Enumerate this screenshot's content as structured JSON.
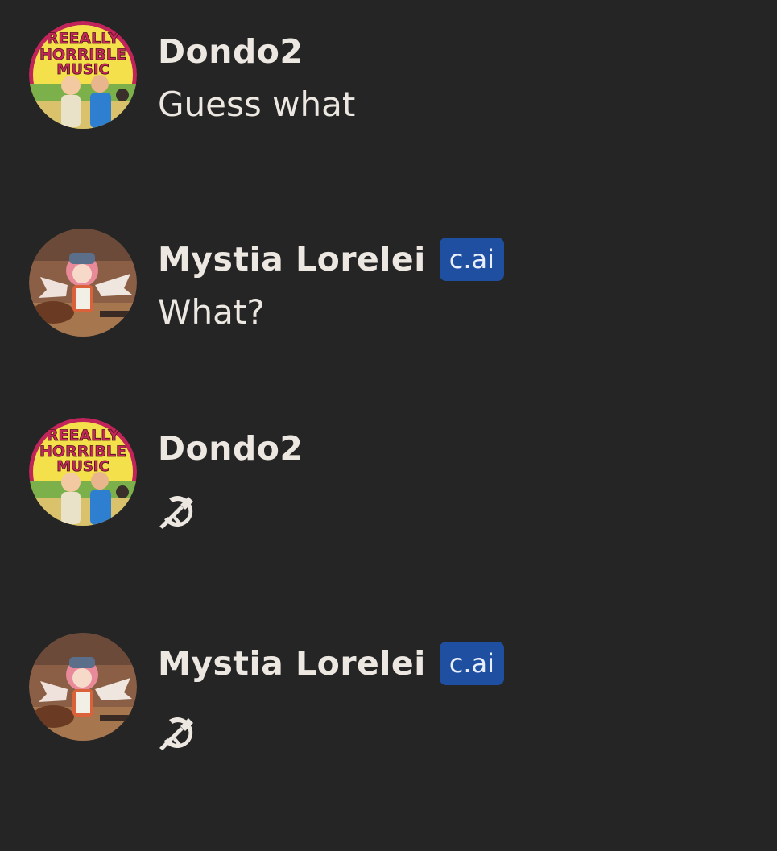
{
  "messages": [
    {
      "author": "Dondo2",
      "avatar_icon": "really-horrible-music-avatar",
      "badge": null,
      "text": "Guess what"
    },
    {
      "author": "Mystia Lorelei",
      "avatar_icon": "mystia-lorelei-avatar",
      "badge": "c.ai",
      "text": "What?"
    },
    {
      "author": "Dondo2",
      "avatar_icon": "really-horrible-music-avatar",
      "badge": null,
      "text": "☭",
      "content_icon": "hammer-and-sickle-icon"
    },
    {
      "author": "Mystia Lorelei",
      "avatar_icon": "mystia-lorelei-avatar",
      "badge": "c.ai",
      "text": "☭",
      "content_icon": "hammer-and-sickle-icon"
    }
  ],
  "avatars": {
    "dondo2": {
      "lettering": [
        "REEALLY",
        "HORRIBLE",
        "MUSIC"
      ],
      "colors": {
        "ring": "#c0245a",
        "bg": "#f3e04a",
        "text": "#c6285a"
      }
    },
    "mystia": {
      "colors": {
        "bg": "#8a5f45",
        "hair": "#e98a9a",
        "hat": "#5b6f8a"
      }
    }
  },
  "colors": {
    "background": "#252525",
    "text": "#ece7e1",
    "badge_bg": "#1f4fa0"
  }
}
